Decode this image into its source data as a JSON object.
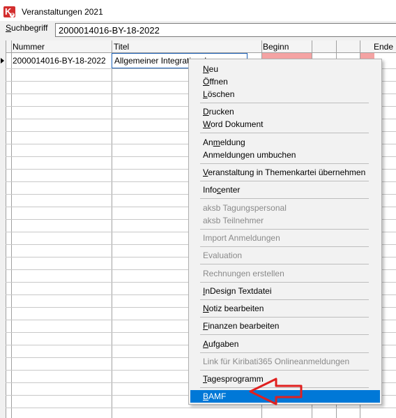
{
  "window": {
    "title": "Veranstaltungen 2021",
    "icon": "kiribati-app-icon"
  },
  "search": {
    "label_prefix": "S",
    "label_rest": "uchbegriff",
    "value": "2000014016-BY-18-2022"
  },
  "grid": {
    "columns": [
      "Nummer",
      "Titel",
      "Beginn",
      "Ende"
    ],
    "rows": [
      {
        "nummer": "2000014016-BY-18-2022",
        "titel": "Allgemeiner Integrationskurs"
      }
    ]
  },
  "context_menu": {
    "items": [
      {
        "label": "Neu",
        "u": "N",
        "enabled": true
      },
      {
        "label": "Öffnen",
        "u": "Ö",
        "enabled": true
      },
      {
        "label": "Löschen",
        "u": "L",
        "enabled": true
      },
      {
        "label": "Drucken",
        "u": "D",
        "enabled": true
      },
      {
        "label": "Word Dokument",
        "u": "W",
        "enabled": true
      },
      {
        "label": "Anmeldung",
        "u": "m",
        "enabled": true
      },
      {
        "label": "Anmeldungen umbuchen",
        "enabled": true
      },
      {
        "label": "Veranstaltung in Themenkartei übernehmen",
        "u": "V",
        "enabled": true
      },
      {
        "label": "Infocenter",
        "u": "c",
        "enabled": true
      },
      {
        "label": "aksb Tagungspersonal",
        "enabled": false
      },
      {
        "label": "aksb Teilnehmer",
        "enabled": false
      },
      {
        "label": "Import Anmeldungen",
        "enabled": false
      },
      {
        "label": "Evaluation",
        "enabled": false
      },
      {
        "label": "Rechnungen erstellen",
        "enabled": false
      },
      {
        "label": "InDesign Textdatei",
        "u": "I",
        "enabled": true
      },
      {
        "label": "Notiz bearbeiten",
        "u": "N",
        "enabled": true
      },
      {
        "label": "Finanzen bearbeiten",
        "u": "F",
        "enabled": true
      },
      {
        "label": "Aufgaben",
        "u": "A",
        "enabled": true
      },
      {
        "label": "Link für Kiribati365 Onlineanmeldungen",
        "enabled": false
      },
      {
        "label": "Tagesprogramm",
        "u": "T",
        "enabled": true
      },
      {
        "label": "BAMF",
        "u": "B",
        "enabled": true,
        "highlighted": true
      }
    ]
  },
  "colors": {
    "highlight": "#0078d7",
    "date_cell": "#f4a3a3",
    "annotation": "#e0201f"
  }
}
